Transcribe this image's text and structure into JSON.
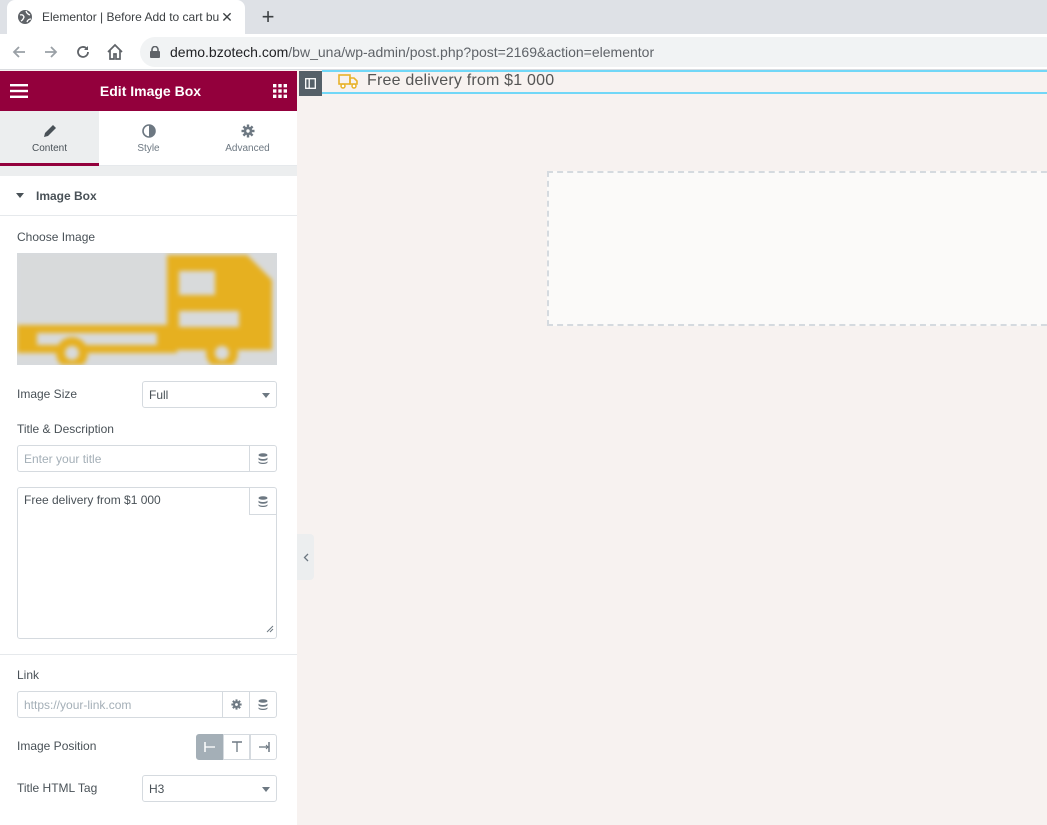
{
  "browser": {
    "tab_title": "Elementor | Before Add to cart bu",
    "url_host": "demo.bzotech.com",
    "url_path": "/bw_una/wp-admin/post.php?post=2169&action=elementor"
  },
  "panel": {
    "header_title": "Edit Image Box",
    "tabs": [
      {
        "label": "Content",
        "icon": "pencil-icon",
        "active": true
      },
      {
        "label": "Style",
        "icon": "half-circle-icon",
        "active": false
      },
      {
        "label": "Advanced",
        "icon": "gear-icon",
        "active": false
      }
    ],
    "section_title": "Image Box",
    "choose_image_label": "Choose Image",
    "image_size_label": "Image Size",
    "image_size_value": "Full",
    "title_desc_label": "Title & Description",
    "title_placeholder": "Enter your title",
    "description_value": "Free delivery from $1 000",
    "link_label": "Link",
    "link_placeholder": "https://your-link.com",
    "image_position_label": "Image Position",
    "title_tag_label": "Title HTML Tag",
    "title_tag_value": "H3"
  },
  "canvas": {
    "delivery_text": "Free delivery from $1 000"
  },
  "colors": {
    "brand": "#93003c",
    "accent_line": "#71d7f7",
    "truck": "#e8b22a"
  }
}
